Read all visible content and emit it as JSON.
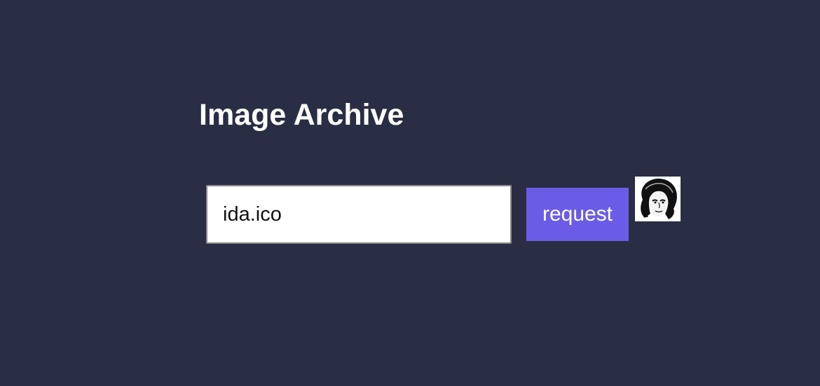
{
  "page": {
    "title": "Image Archive"
  },
  "form": {
    "filename_value": "ida.ico",
    "request_label": "request"
  },
  "preview": {
    "icon": "portrait-thumbnail"
  },
  "colors": {
    "background": "#2a2e44",
    "button": "#6b5ce7",
    "title_text": "#ffffff"
  }
}
